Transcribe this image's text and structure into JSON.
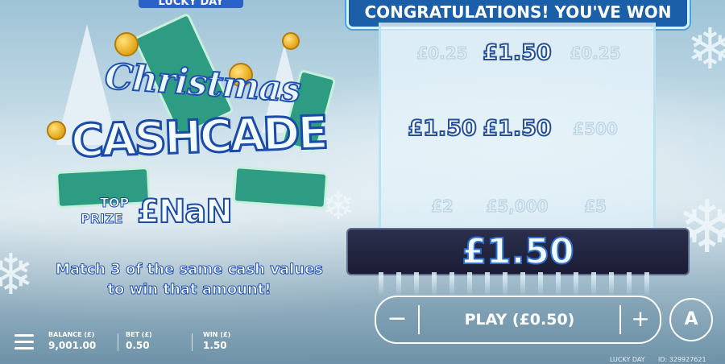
{
  "brand": "LUCKY DAY",
  "title": {
    "line1": "Christmas",
    "line2": "CASHCADE"
  },
  "prize": {
    "top": "TOP",
    "label": "PRIZE",
    "value": "£NaN"
  },
  "instructions": "Match 3 of the same cash values to win that amount!",
  "banner": "CONGRATULATIONS! YOU'VE WON",
  "grid": [
    [
      {
        "value": "£0.25",
        "win": false
      },
      {
        "value": "£1.50",
        "win": true
      },
      {
        "value": "£0.25",
        "win": false
      }
    ],
    [
      {
        "value": "£1.50",
        "win": true
      },
      {
        "value": "£1.50",
        "win": true
      },
      {
        "value": "£500",
        "win": false
      }
    ],
    [
      {
        "value": "£2",
        "win": false
      },
      {
        "value": "£5,000",
        "win": false
      },
      {
        "value": "£5",
        "win": false
      }
    ]
  ],
  "win_amount": "£1.50",
  "controls": {
    "minus": "−",
    "play": "PLAY (£0.50)",
    "plus": "+",
    "auto": "A"
  },
  "footer": {
    "balance_label": "BALANCE (£)",
    "balance": "9,001.00",
    "bet_label": "BET (£)",
    "bet": "0.50",
    "win_label": "WIN (£)",
    "win": "1.50",
    "operator": "LUCKY DAY",
    "id_text": "ID: 329927621"
  },
  "icons": [
    "menu-icon",
    "snowflake-icon",
    "coin-icon"
  ]
}
